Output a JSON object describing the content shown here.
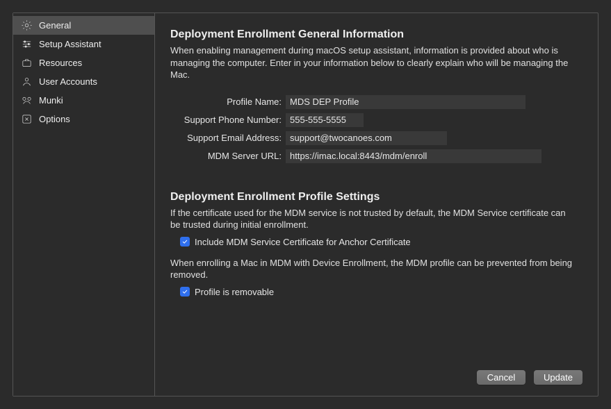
{
  "sidebar": {
    "items": [
      {
        "label": "General"
      },
      {
        "label": "Setup Assistant"
      },
      {
        "label": "Resources"
      },
      {
        "label": "User Accounts"
      },
      {
        "label": "Munki"
      },
      {
        "label": "Options"
      }
    ]
  },
  "section1": {
    "heading": "Deployment Enrollment General Information",
    "desc": "When enabling management during macOS setup assistant, information is provided about who is managing the computer. Enter in your information below to clearly explain who will be managing the Mac.",
    "fields": {
      "profileName": {
        "label": "Profile Name:",
        "value": "MDS DEP Profile"
      },
      "supportPhone": {
        "label": "Support Phone Number:",
        "value": "555-555-5555"
      },
      "supportEmail": {
        "label": "Support Email Address:",
        "value": "support@twocanoes.com"
      },
      "mdmUrl": {
        "label": "MDM Server URL:",
        "value": "https://imac.local:8443/mdm/enroll"
      }
    }
  },
  "section2": {
    "heading": "Deployment Enrollment Profile Settings",
    "desc1": "If the certificate used for the MDM service is not trusted by default, the MDM Service certificate can be trusted during initial enrollment.",
    "cb1": "Include MDM Service Certificate for Anchor Certificate",
    "desc2": "When enrolling a Mac in MDM with Device Enrollment, the MDM profile can be prevented from being removed.",
    "cb2": "Profile is removable"
  },
  "footer": {
    "cancel": "Cancel",
    "update": "Update"
  }
}
